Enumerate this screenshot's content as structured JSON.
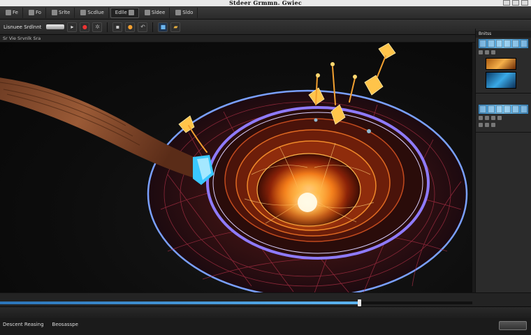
{
  "window": {
    "title": "Stdeer Grmmn. Gwiec"
  },
  "toolbar": {
    "items": [
      {
        "label": "Fe"
      },
      {
        "label": "Fo"
      },
      {
        "label": "Srlte"
      },
      {
        "label": "Scdlue"
      },
      {
        "label": "Edlle"
      },
      {
        "label": "Sldee"
      },
      {
        "label": "Sldo"
      }
    ],
    "row2_label": "Lisnuee Srdlnnt"
  },
  "panel_strip": {
    "label": "Sr Vie Srvnlk Sra"
  },
  "right_panel": {
    "header": "Bnitss"
  },
  "timeline": {
    "progress": 0.76
  },
  "status": {
    "labels": [
      "Descent Reasing",
      "Beosasspe"
    ]
  },
  "colors": {
    "accent": "#2b74b8",
    "fire": "#ffb040",
    "ring": "#6a5cff"
  }
}
